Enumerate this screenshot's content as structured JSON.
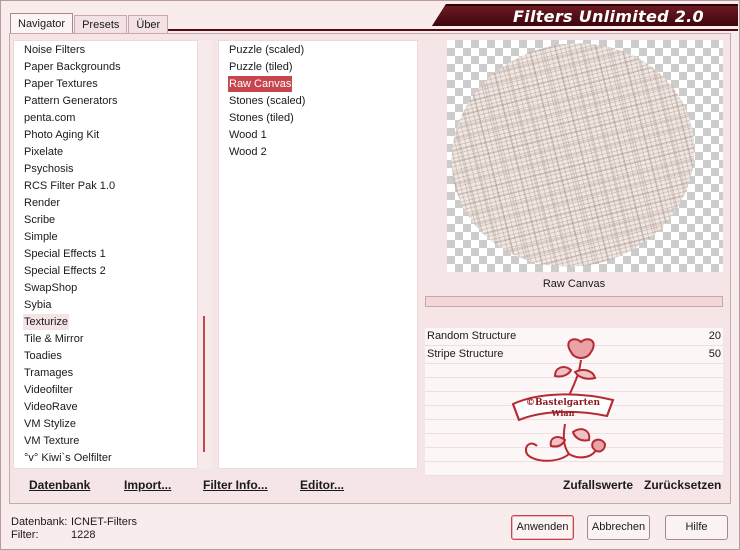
{
  "tabs": [
    "Navigator",
    "Presets",
    "Über"
  ],
  "title": "Filters Unlimited 2.0",
  "categories": [
    "Noise Filters",
    "Paper Backgrounds",
    "Paper Textures",
    "Pattern Generators",
    "penta.com",
    "Photo Aging Kit",
    "Pixelate",
    "Psychosis",
    "RCS Filter Pak 1.0",
    "Render",
    "Scribe",
    "Simple",
    "Special Effects 1",
    "Special Effects 2",
    "SwapShop",
    "Sybia",
    "Texturize",
    "Tile & Mirror",
    "Toadies",
    "Tramages",
    "Videofilter",
    "VideoRave",
    "VM Stylize",
    "VM Texture",
    "°v° Kiwi`s Oelfilter"
  ],
  "selected_category": "Texturize",
  "filters": [
    "Puzzle (scaled)",
    "Puzzle (tiled)",
    "Raw Canvas",
    "Stones (scaled)",
    "Stones (tiled)",
    "Wood 1",
    "Wood 2"
  ],
  "selected_filter": "Raw Canvas",
  "preview": {
    "name": "Raw Canvas"
  },
  "params": [
    {
      "label": "Random Structure",
      "value": "20"
    },
    {
      "label": "Stripe Structure",
      "value": "50"
    }
  ],
  "watermark": {
    "line1": "©Bastelgarten",
    "line2": "Wian"
  },
  "actions": {
    "datenbank": "Datenbank",
    "import": "Import...",
    "filter_info": "Filter Info...",
    "editor": "Editor...",
    "zufallswerte": "Zufallswerte",
    "zuruecksetzen": "Zurücksetzen"
  },
  "footer": {
    "db_label": "Datenbank:",
    "db_value": "ICNET-Filters",
    "filter_label": "Filter:",
    "filter_value": "1228"
  },
  "buttons": {
    "apply": "Anwenden",
    "cancel": "Abbrechen",
    "help": "Hilfe"
  },
  "colors": {
    "accent": "#c7464d",
    "banner": "#4e0d13",
    "background": "#f9eced"
  }
}
